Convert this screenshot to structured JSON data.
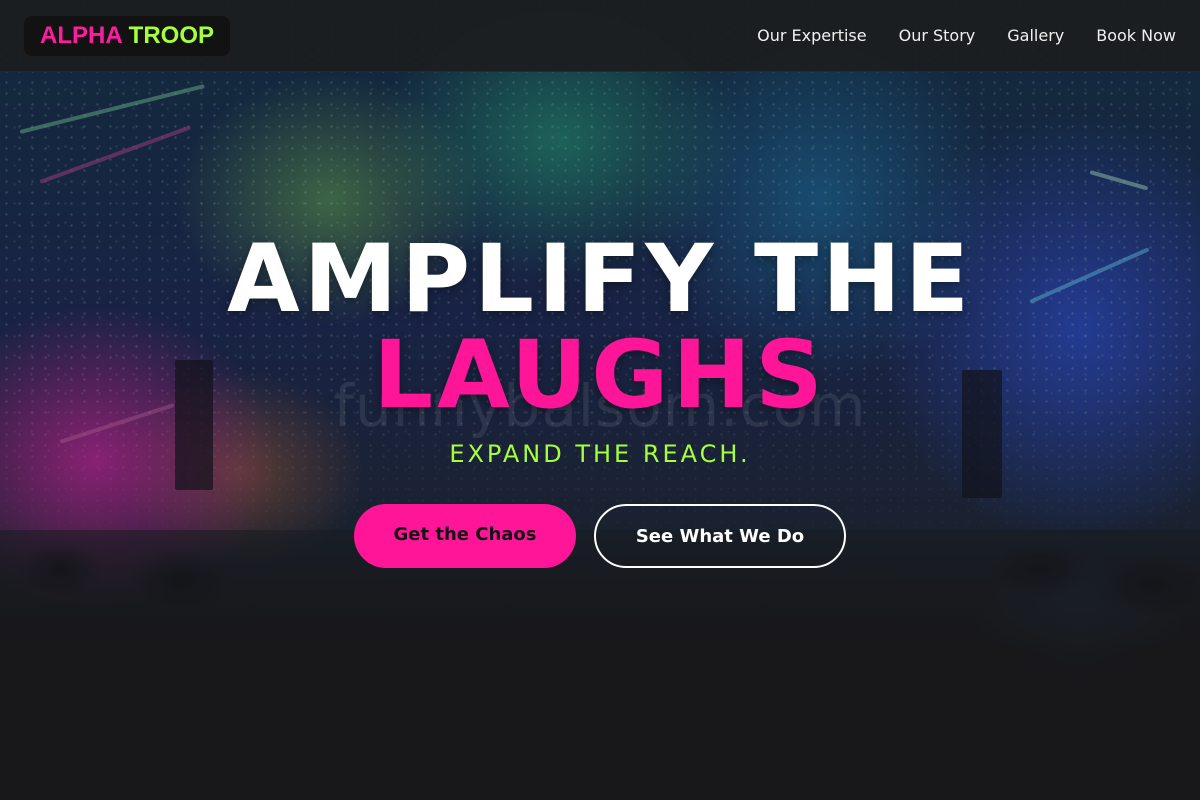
{
  "brand": {
    "part1": "ALPHA",
    "part2": "TROOP",
    "colors": {
      "pink": "#ff1597",
      "green": "#a6ff3c"
    }
  },
  "nav": {
    "links": [
      "Our Expertise",
      "Our Story",
      "Gallery",
      "Book Now"
    ]
  },
  "hero": {
    "headline_line1": "AMPLIFY THE",
    "headline_line2": "LAUGHS",
    "tagline": "EXPAND THE REACH.",
    "watermark": "funnybalsom.com",
    "primary_cta": "Get the Chaos",
    "secondary_cta": "See What We Do",
    "background": "concert-crowd-stage-lights-image"
  }
}
